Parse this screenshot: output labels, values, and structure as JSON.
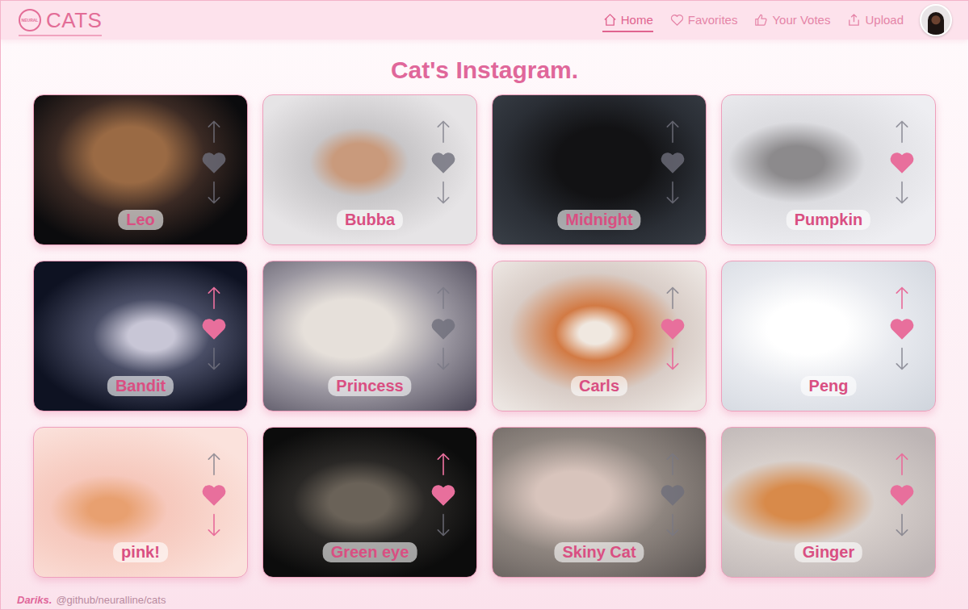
{
  "header": {
    "logo": {
      "badge": "NEURAL",
      "title": "CATS"
    },
    "nav": [
      {
        "label": "Home",
        "selected": true
      },
      {
        "label": "Favorites",
        "selected": false
      },
      {
        "label": "Your Votes",
        "selected": false
      },
      {
        "label": "Upload",
        "selected": false
      }
    ]
  },
  "title": "Cat's Instagram.",
  "cards": [
    {
      "name": "Leo",
      "favorite": false,
      "voted_up": false,
      "voted_down": false
    },
    {
      "name": "Bubba",
      "favorite": false,
      "voted_up": false,
      "voted_down": false
    },
    {
      "name": "Midnight",
      "favorite": false,
      "voted_up": false,
      "voted_down": false
    },
    {
      "name": "Pumpkin",
      "favorite": true,
      "voted_up": false,
      "voted_down": false
    },
    {
      "name": "Bandit",
      "favorite": true,
      "voted_up": true,
      "voted_down": false
    },
    {
      "name": "Princess",
      "favorite": false,
      "voted_up": false,
      "voted_down": false
    },
    {
      "name": "Carls",
      "favorite": true,
      "voted_up": false,
      "voted_down": true
    },
    {
      "name": "Peng",
      "favorite": true,
      "voted_up": true,
      "voted_down": false
    },
    {
      "name": "pink!",
      "favorite": true,
      "voted_up": false,
      "voted_down": true
    },
    {
      "name": "Green eye",
      "favorite": true,
      "voted_up": true,
      "voted_down": false
    },
    {
      "name": "Skiny Cat",
      "favorite": false,
      "voted_up": false,
      "voted_down": false
    },
    {
      "name": "Ginger",
      "favorite": true,
      "voted_up": true,
      "voted_down": false
    }
  ],
  "footer": {
    "author": "Dariks.",
    "link": "@github/neuralline/cats"
  }
}
